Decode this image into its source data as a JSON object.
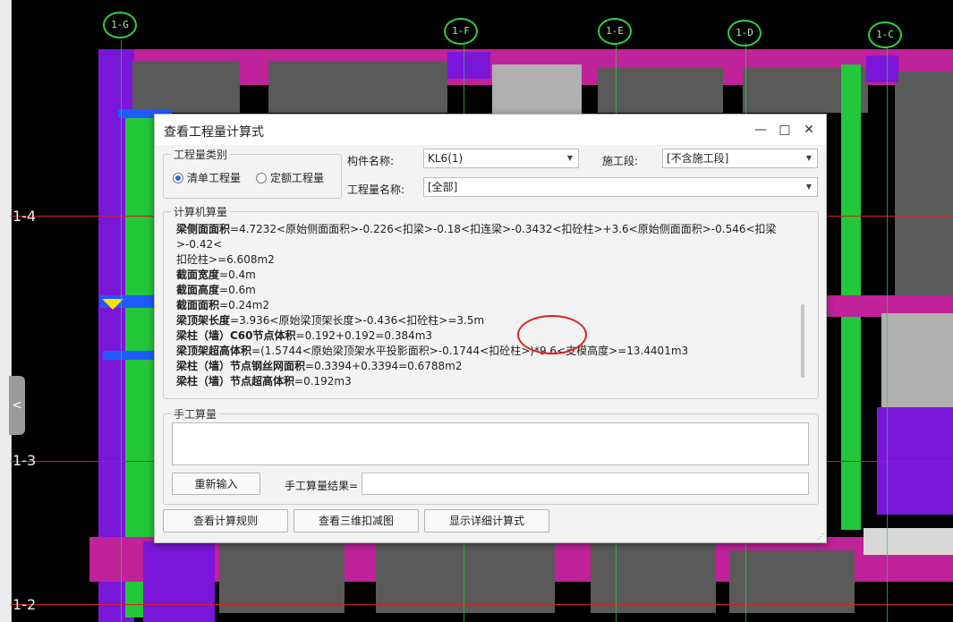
{
  "background": {
    "axis_bubbles": [
      "1-G",
      "1-F",
      "1-E",
      "1-D",
      "1-C"
    ],
    "axis_labels": [
      "1-4",
      "1-3",
      "1-2"
    ],
    "left_tab_glyph": "<"
  },
  "dialog": {
    "title": "查看工程量计算式",
    "window_buttons": {
      "minimize": "—",
      "maximize": "□",
      "close": "✕"
    },
    "quantity_type": {
      "legend": "工程量类别",
      "options": [
        "清单工程量",
        "定额工程量"
      ],
      "selected": "清单工程量"
    },
    "component_name": {
      "label": "构件名称:",
      "value": "KL6(1)"
    },
    "construction_section": {
      "label": "施工段:",
      "value": "[不含施工段]"
    },
    "quantity_name": {
      "label": "工程量名称:",
      "value": "[全部]"
    },
    "computed": {
      "legend": "计算机算量",
      "lines": [
        {
          "name": "梁侧面面积",
          "expr": "=4.7232<原始侧面面积>-0.226<扣梁>-0.18<扣连梁>-0.3432<扣砼柱>+3.6<原始侧面面积>-0.546<扣梁>-0.42<"
        },
        {
          "name": "",
          "expr": "扣砼柱>=6.608m2"
        },
        {
          "name": "截面宽度",
          "expr": "=0.4m"
        },
        {
          "name": "截面高度",
          "expr": "=0.6m"
        },
        {
          "name": "截面面积",
          "expr": "=0.24m2"
        },
        {
          "name": "梁顶架长度",
          "expr": "=3.936<原始梁顶架长度>-0.436<扣砼柱>=3.5m"
        },
        {
          "name": "梁柱（墙）C60节点体积",
          "expr": "=0.192+0.192=0.384m3"
        },
        {
          "name": "梁顶架超高体积",
          "expr": "=(1.5744<原始梁顶架水平投影面积>-0.1744<扣砼柱>)*9.6<支模高度>=13.4401m3"
        },
        {
          "name": "梁柱（墙）节点钢丝网面积",
          "expr": "=0.3394+0.3394=0.6788m2"
        },
        {
          "name": "梁柱（墙）节点超高体积",
          "expr": "=0.192m3"
        }
      ]
    },
    "manual": {
      "legend": "手工算量",
      "reenter_label": "重新输入",
      "result_label": "手工算量结果=",
      "result_value": ""
    },
    "footer_buttons": {
      "rules": "查看计算规则",
      "view3d": "查看三维扣减图",
      "detail": "显示详细计算式"
    }
  }
}
